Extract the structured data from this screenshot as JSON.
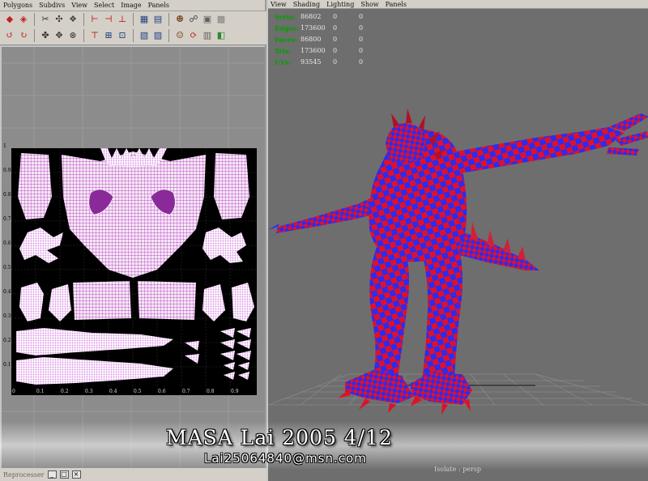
{
  "uv_editor": {
    "menu": [
      "Polygons",
      "Subdivs",
      "View",
      "Select",
      "Image",
      "Panels"
    ],
    "status_label": "Reprocesser",
    "axis_ticks_y": [
      "1",
      "0.9",
      "0.8",
      "0.7",
      "0.6",
      "0.5",
      "0.4",
      "0.3",
      "0.2",
      "0.1"
    ],
    "axis_ticks_x": [
      "0",
      "0.1",
      "0.2",
      "0.3",
      "0.4",
      "0.5",
      "0.6",
      "0.7",
      "0.8",
      "0.9"
    ]
  },
  "viewport": {
    "menu": [
      "View",
      "Shading",
      "Lighting",
      "Show",
      "Panels"
    ],
    "stats": [
      {
        "label": "Verts:",
        "v1": "86802",
        "v2": "0",
        "v3": "0"
      },
      {
        "label": "Edges:",
        "v1": "173600",
        "v2": "0",
        "v3": "0"
      },
      {
        "label": "Faces:",
        "v1": "86800",
        "v2": "0",
        "v3": "0"
      },
      {
        "label": "Tris:",
        "v1": "173600",
        "v2": "0",
        "v3": "0"
      },
      {
        "label": "UVs:",
        "v1": "93545",
        "v2": "0",
        "v3": "0"
      }
    ],
    "camera_label": "Isolate : persp",
    "checker_colors": {
      "a": "#e0102a",
      "b": "#2a2cf0"
    }
  },
  "credits": {
    "title": "MASA Lai 2005 4/12",
    "email": "Lai25064840@msn.com"
  }
}
